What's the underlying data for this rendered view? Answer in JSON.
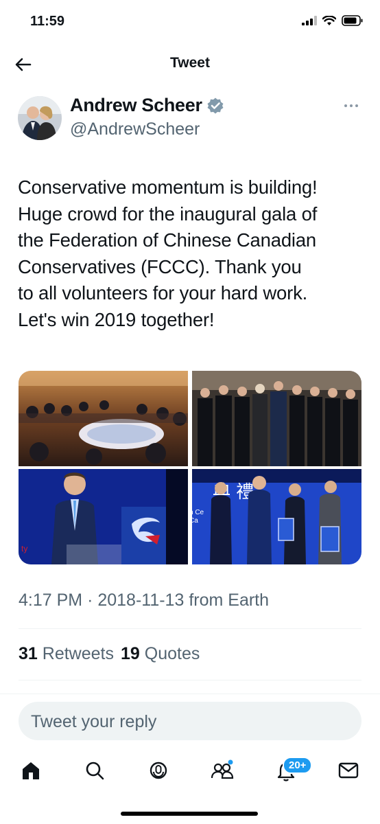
{
  "status": {
    "time": "11:59"
  },
  "header": {
    "title": "Tweet"
  },
  "author": {
    "name": "Andrew Scheer",
    "handle": "@AndrewScheer"
  },
  "tweet": {
    "lines": [
      "Conservative momentum is building!",
      "Huge crowd for the inaugural gala of",
      "the Federation of Chinese Canadian",
      "Conservatives (FCCC). Thank you",
      "to all volunteers for your hard work.",
      "Let's win 2019 together!"
    ],
    "time": "4:17 PM",
    "date": "2018-11-13",
    "source": "from Earth",
    "retweets_count": "31",
    "retweets_label": "Retweets",
    "quotes_count": "19",
    "quotes_label": "Quotes"
  },
  "reply": {
    "placeholder": "Tweet your reply"
  },
  "tabbar": {
    "notifications_badge": "20+"
  },
  "colors": {
    "accent": "#1d9bf0",
    "secondary_text": "#536471",
    "primary_text": "#0f1419"
  }
}
